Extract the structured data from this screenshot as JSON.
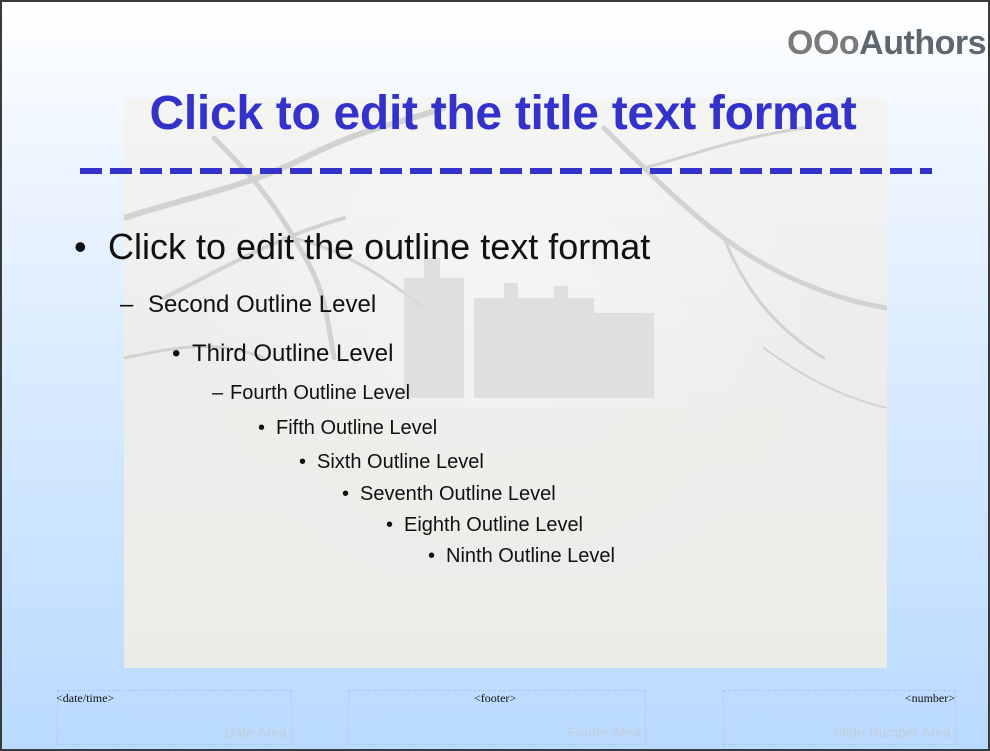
{
  "logo": {
    "ooo": "OOo",
    "authors": "Authors"
  },
  "title": "Click to edit the title text format",
  "outline": [
    {
      "marker": "•",
      "text": "Click to edit the outline text format"
    },
    {
      "marker": "–",
      "text": "Second Outline Level"
    },
    {
      "marker": "•",
      "text": "Third Outline Level"
    },
    {
      "marker": "–",
      "text": "Fourth Outline Level"
    },
    {
      "marker": "•",
      "text": "Fifth Outline Level"
    },
    {
      "marker": "•",
      "text": "Sixth Outline Level"
    },
    {
      "marker": "•",
      "text": "Seventh Outline Level"
    },
    {
      "marker": "•",
      "text": "Eighth Outline Level"
    },
    {
      "marker": "•",
      "text": "Ninth Outline Level"
    }
  ],
  "footer": {
    "date": {
      "field": "<date/time>",
      "area": "Date Area"
    },
    "footer": {
      "field": "<footer>",
      "area": "Footer Area"
    },
    "number": {
      "field": "<number>",
      "area": "Slide Number Area"
    }
  },
  "colors": {
    "title": "#3333cc",
    "background_top": "#ffffff",
    "background_bottom": "#b9daff"
  }
}
